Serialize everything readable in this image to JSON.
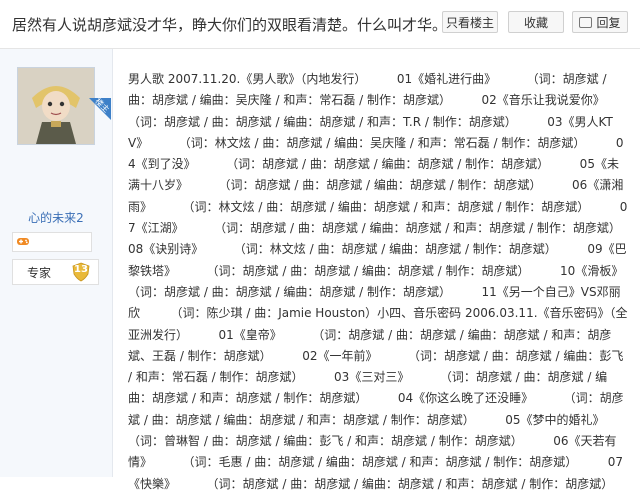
{
  "header": {
    "title": "居然有人说胡彦斌没才华，睁大你们的双眼看清楚。什么叫才华。",
    "only_op_label": "只看楼主",
    "favorite_label": "收藏",
    "reply_label": "回复"
  },
  "author": {
    "op_badge": "楼主",
    "username": "心的未来2",
    "level_name": "专家",
    "level_number": "13",
    "icons": {
      "game": "game-controller-icon",
      "level": "shield-badge-icon"
    }
  },
  "post": {
    "body": "男人歌 2007.11.20.《男人歌》（内地发行）        01《婚礼进行曲》        （词：胡彦斌 / 曲：胡彦斌 / 编曲：吴庆隆 / 和声：常石磊 / 制作：胡彦斌）        02《音乐让我说爱你》        （词：胡彦斌 / 曲：胡彦斌 / 编曲：胡彦斌 / 和声：T.R / 制作：胡彦斌）        03《男人KTV》        （词：林文炫 / 曲：胡彦斌 / 编曲：吴庆隆 / 和声：常石磊 / 制作：胡彦斌）        04《到了没》        （词：胡彦斌 / 曲：胡彦斌 / 编曲：胡彦斌 / 制作：胡彦斌）        05《未满十八岁》        （词：胡彦斌 / 曲：胡彦斌 / 编曲：胡彦斌 / 制作：胡彦斌）        06《潇湘雨》        （词：林文炫 / 曲：胡彦斌 / 编曲：胡彦斌 / 和声：胡彦斌 / 制作：胡彦斌）        07《江湖》        （词：胡彦斌 / 曲：胡彦斌 / 编曲：胡彦斌 / 和声：胡彦斌 / 制作：胡彦斌）        08《诀别诗》        （词：林文炫 / 曲：胡彦斌 / 编曲：胡彦斌 / 制作：胡彦斌）        09《巴黎铁塔》        （词：胡彦斌 / 曲：胡彦斌 / 编曲：胡彦斌 / 制作：胡彦斌）        10《滑板》        （词：胡彦斌 / 曲：胡彦斌 / 编曲：胡彦斌 / 制作：胡彦斌）        11《另一个自己》VS邓丽欣        （词：陈少琪 / 曲：Jamie Houston）小四、音乐密码 2006.03.11.《音乐密码》（全亚洲发行）        01《皇帝》        （词：胡彦斌 / 曲：胡彦斌 / 编曲：胡彦斌 / 和声：胡彦斌、王磊 / 制作：胡彦斌）        02《一年前》        （词：胡彦斌 / 曲：胡彦斌 / 编曲：彭飞 / 和声：常石磊 / 制作：胡彦斌）        03《三对三》        （词：胡彦斌 / 曲：胡彦斌 / 编曲：胡彦斌 / 和声：胡彦斌 / 制作：胡彦斌）        04《你这么晚了还没睡》        （词：胡彦斌 / 曲：胡彦斌 / 编曲：胡彦斌 / 和声：胡彦斌 / 制作：胡彦斌）        05《梦中的婚礼》        （词：曾琳智 / 曲：胡彦斌 / 编曲：彭飞 / 和声：胡彦斌 / 制作：胡彦斌）        06《天若有情》        （词：毛惠 / 曲：胡彦斌 / 编曲：胡彦斌 / 和声：胡彦斌 / 制作：胡彦斌）        07《快樂》        （词：胡彦斌 / 曲：胡彦斌 / 编曲：胡彦斌 / 和声：胡彦斌 / 制作：胡彦斌）"
  }
}
